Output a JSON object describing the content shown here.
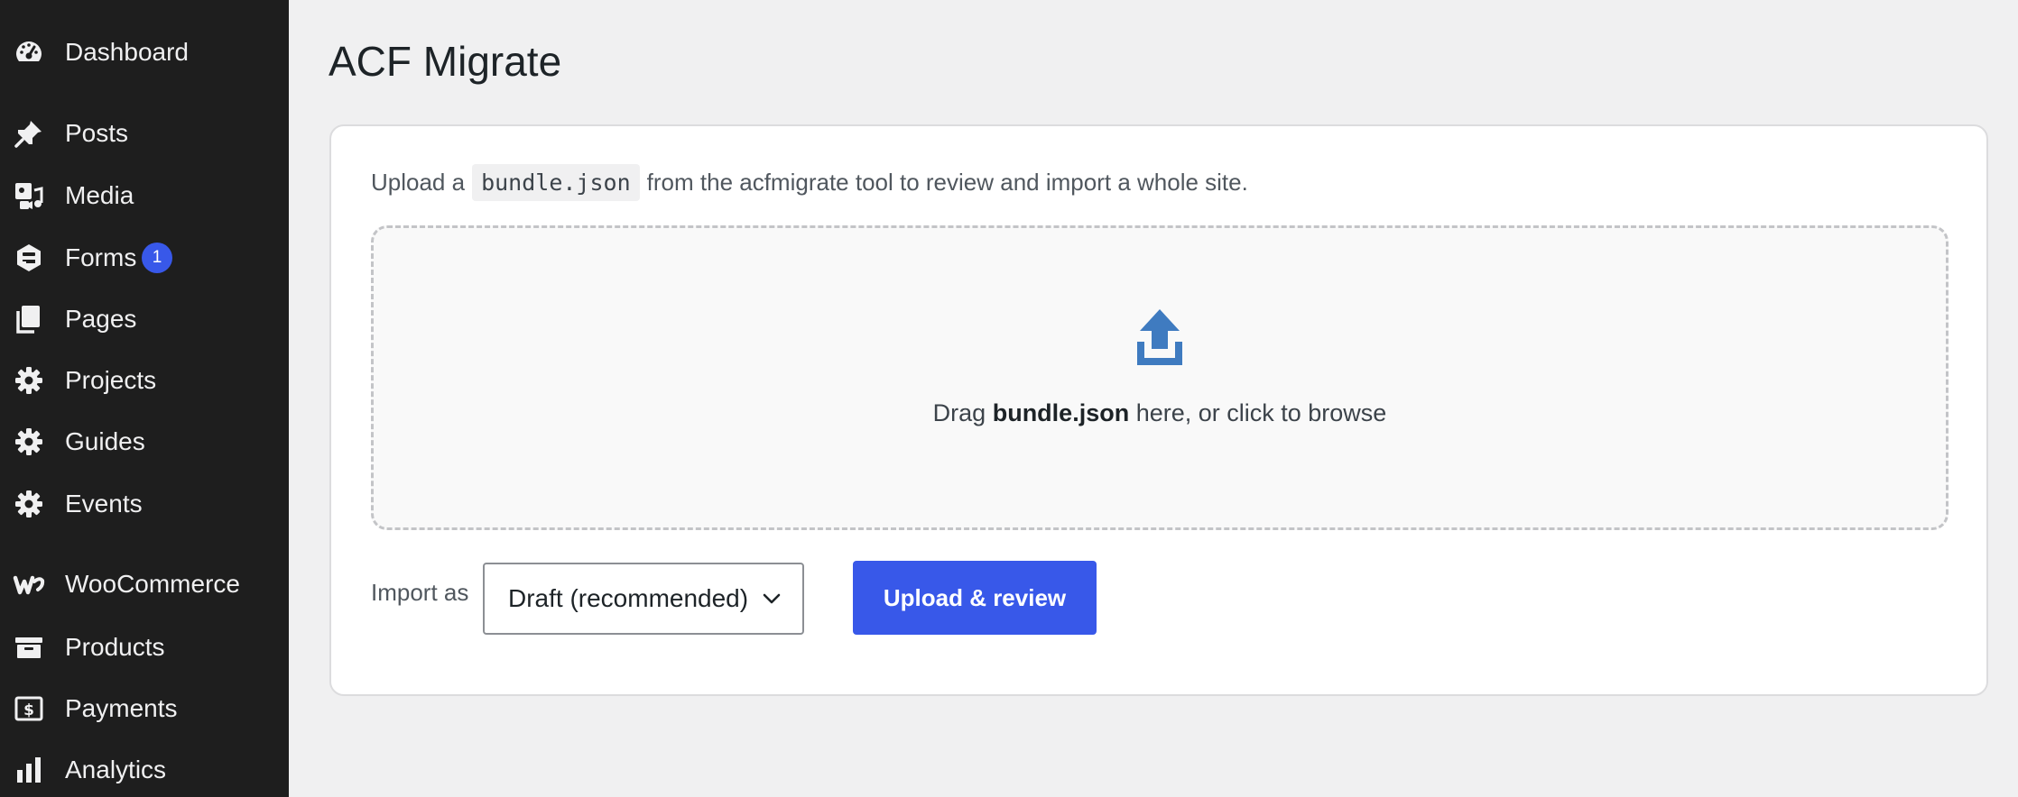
{
  "sidebar": {
    "items": [
      {
        "label": "Dashboard",
        "icon": "dashboard-icon"
      },
      {
        "label": "Posts",
        "icon": "pin-icon"
      },
      {
        "label": "Media",
        "icon": "media-icon"
      },
      {
        "label": "Forms",
        "icon": "forms-icon",
        "badge": "1"
      },
      {
        "label": "Pages",
        "icon": "pages-icon"
      },
      {
        "label": "Projects",
        "icon": "gear-icon"
      },
      {
        "label": "Guides",
        "icon": "gear-icon"
      },
      {
        "label": "Events",
        "icon": "gear-icon"
      },
      {
        "label": "WooCommerce",
        "icon": "woocommerce-icon"
      },
      {
        "label": "Products",
        "icon": "archive-icon"
      },
      {
        "label": "Payments",
        "icon": "dollar-icon"
      },
      {
        "label": "Analytics",
        "icon": "bar-chart-icon"
      }
    ]
  },
  "main": {
    "title": "ACF Migrate",
    "intro_before": "Upload a",
    "intro_code": "bundle.json",
    "intro_after": "from the acfmigrate tool to review and import a whole site.",
    "dropzone": {
      "icon": "upload-icon",
      "text_before": "Drag",
      "text_bold": "bundle.json",
      "text_after": "here, or click to browse"
    },
    "import_label": "Import as",
    "import_select_value": "Draft (recommended)",
    "upload_button": "Upload & review"
  },
  "colors": {
    "sidebar_bg": "#1e1e1e",
    "accent": "#3858e9",
    "upload_icon": "#3f7bc0",
    "page_bg": "#f0f0f1"
  }
}
